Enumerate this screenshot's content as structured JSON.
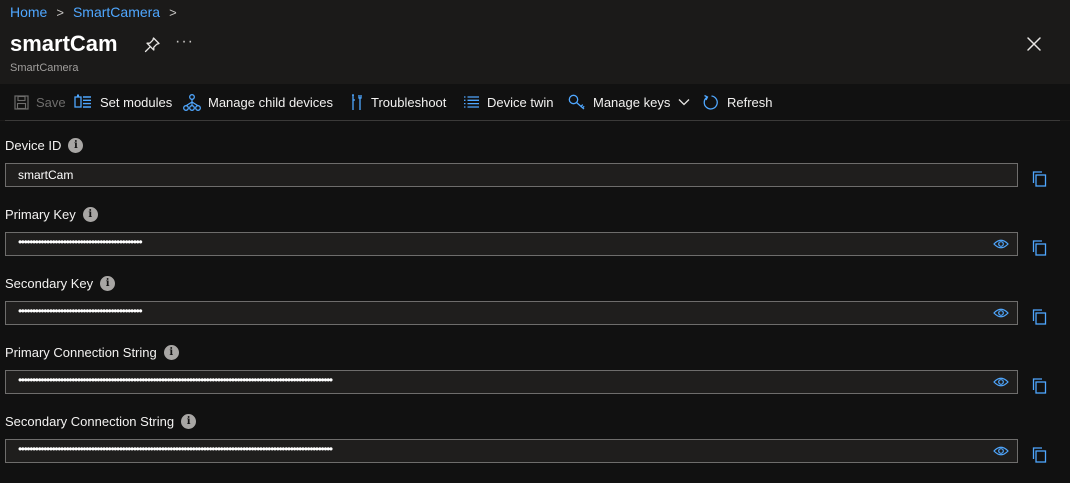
{
  "breadcrumb": {
    "home": "Home",
    "parent": "SmartCamera",
    "sep": ">"
  },
  "header": {
    "title": "smartCam",
    "subtitle": "SmartCamera",
    "more": "···"
  },
  "toolbar": {
    "save": "Save",
    "set_modules": "Set modules",
    "manage_child_devices": "Manage child devices",
    "troubleshoot": "Troubleshoot",
    "device_twin": "Device twin",
    "manage_keys": "Manage keys",
    "refresh": "Refresh"
  },
  "fields": {
    "device_id": {
      "label": "Device ID",
      "value": "smartCam"
    },
    "primary_key": {
      "label": "Primary Key",
      "value": "••••••••••••••••••••••••••••••••••••••••••••"
    },
    "secondary_key": {
      "label": "Secondary Key",
      "value": "••••••••••••••••••••••••••••••••••••••••••••"
    },
    "primary_conn": {
      "label": "Primary Connection String",
      "value": "••••••••••••••••••••••••••••••••••••••••••••••••••••••••••••••••••••••••••••••••••••••••••••••••••••••••••••••••"
    },
    "secondary_conn": {
      "label": "Secondary Connection String",
      "value": "••••••••••••••••••••••••••••••••••••••••••••••••••••••••••••••••••••••••••••••••••••••••••••••••••••••••••••••••"
    }
  },
  "info_glyph": "i",
  "colors": {
    "accent": "#4fa7ff",
    "background": "#111111",
    "header_bg": "#1b1a19",
    "border": "#6e6d6c"
  },
  "icons": [
    "pin-icon",
    "more-icon",
    "close-icon",
    "save-icon",
    "set-modules-icon",
    "child-devices-icon",
    "troubleshoot-icon",
    "device-twin-icon",
    "key-icon",
    "chevron-down-icon",
    "refresh-icon",
    "info-icon",
    "eye-icon",
    "copy-icon"
  ]
}
